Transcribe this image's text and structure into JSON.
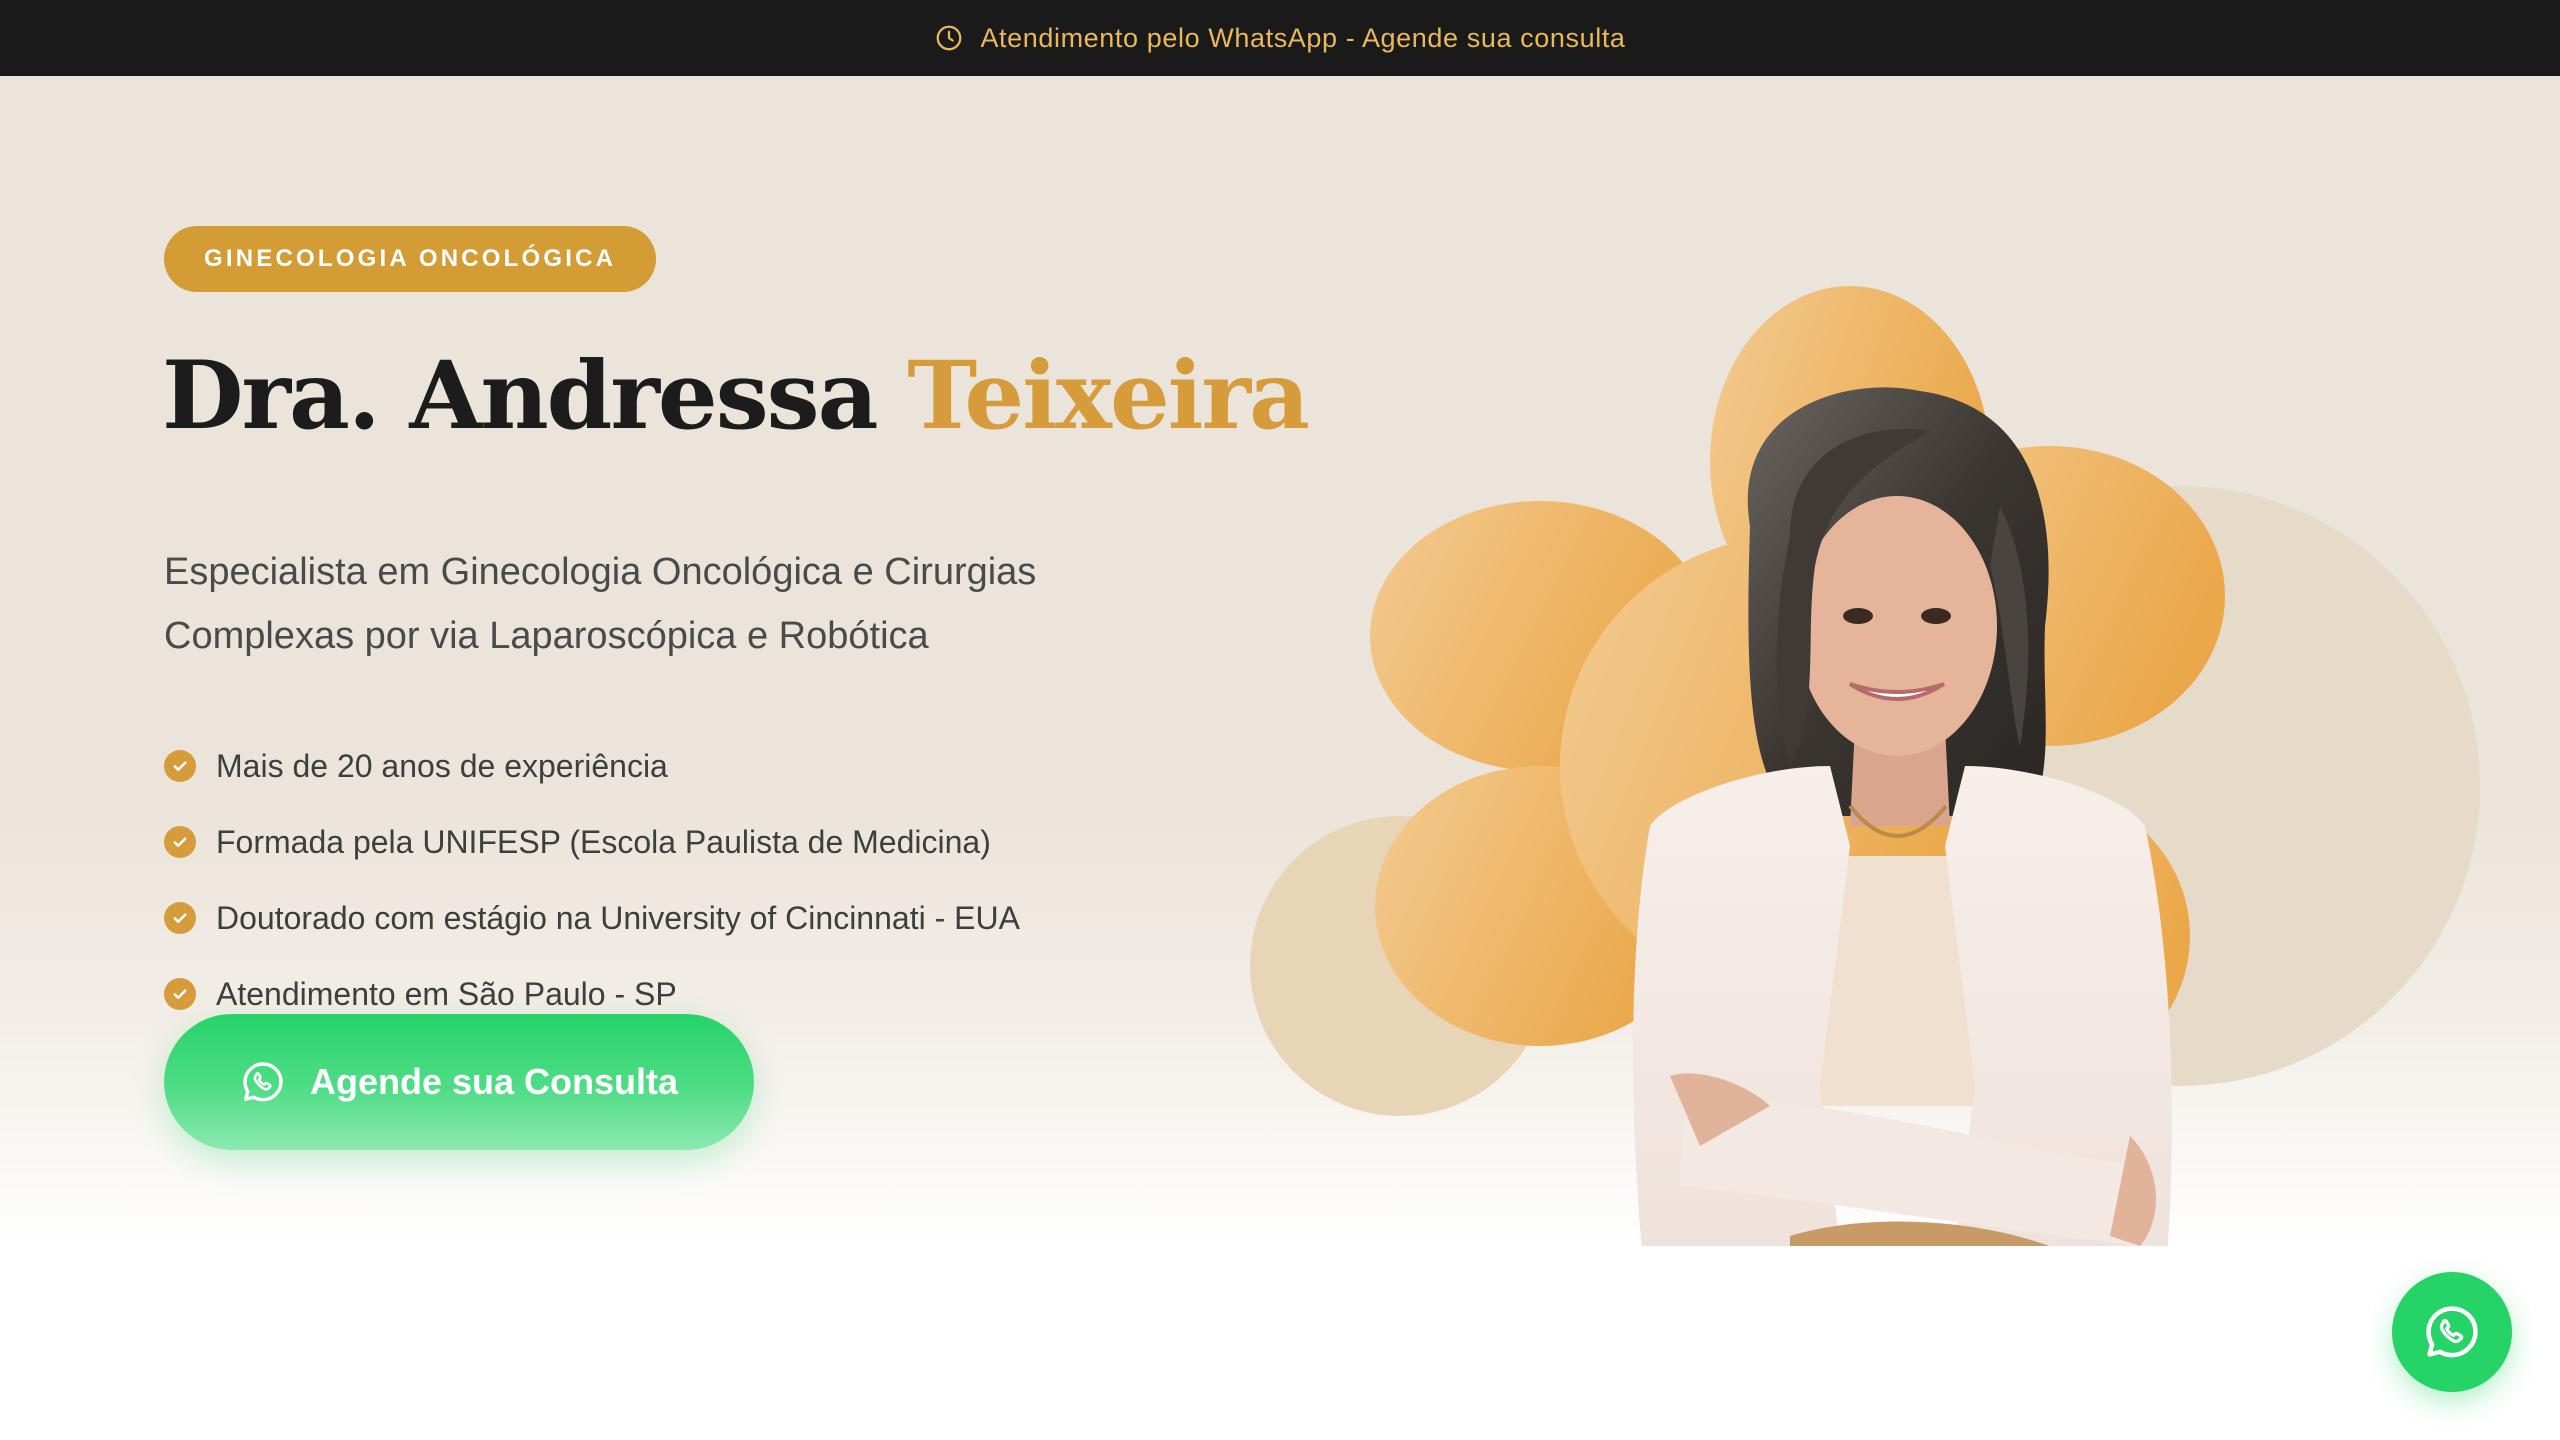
{
  "topbar": {
    "icon": "clock-icon",
    "text": "Atendimento pelo WhatsApp - Agende sua consulta",
    "color": "#e8b85b",
    "background": "#1a1a1a"
  },
  "hero": {
    "badge": "GINECOLOGIA ONCOLÓGICA",
    "title_first": "Dra. Andressa",
    "title_accent": "Teixeira",
    "subtitle_line1": "Especialista em Ginecologia Oncológica e Cirurgias",
    "subtitle_line2": "Complexas por via Laparoscópica e Robótica",
    "features": [
      "Mais de 20 anos de experiência",
      "Formada pela UNIFESP (Escola Paulista de Medicina)",
      "Doutorado com estágio na University of Cincinnati - EUA",
      "Atendimento em São Paulo - SP"
    ],
    "cta_label": "Agende sua Consulta",
    "cta_icon": "whatsapp-icon",
    "portrait_icon": "doctor-portrait",
    "floating_button_icon": "whatsapp-icon"
  },
  "colors": {
    "accent": "#d69c3c",
    "badge": "#d39c35",
    "background": "#ebe4da",
    "whatsapp": "#25d366",
    "dark": "#1c1c1c"
  }
}
